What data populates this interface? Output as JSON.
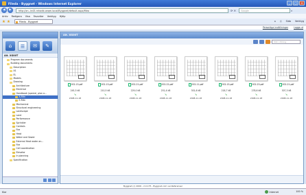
{
  "window": {
    "title": "Fileda - Byggnet - Windows Internet Explorer"
  },
  "address_bar": {
    "url": "http://xn--ln43-rnhadb.xeqm.local/Byggnet/default.aspx/fileo",
    "search_placeholder": "Google"
  },
  "menu": [
    "Arkiv",
    "Redigera",
    "Visa",
    "Favoriter",
    "Verktyg",
    "Hjälp"
  ],
  "tab": {
    "label": "Fileda - Byggnet"
  },
  "fav_tools": [
    "Sida",
    "Verktyg"
  ],
  "app_links": [
    "Personliga inställningar",
    "Logga ut"
  ],
  "right_header": "Alt. XG00T",
  "right_search_placeholder": "Sök i ritning",
  "sidebar": {
    "title": "Alt. XG00T",
    "tree": [
      {
        "label": "Program documents",
        "level": 1
      },
      {
        "label": "Building documents",
        "level": 1
      },
      {
        "label": "Description",
        "level": 2
      },
      {
        "label": "A1",
        "level": 2
      },
      {
        "label": "EL",
        "level": 2
      },
      {
        "label": "Models",
        "level": 2
      },
      {
        "label": "Drawing",
        "level": 2
      },
      {
        "label": "Architecture",
        "level": 3
      },
      {
        "label": "Electrical",
        "level": 3
      },
      {
        "label": "Handbook (special, plan o...",
        "level": 3
      },
      {
        "label": "A-Ritn",
        "level": 4,
        "selected": true
      },
      {
        "label": "E-Ritn",
        "level": 4
      },
      {
        "label": "Mechanical",
        "level": 3
      },
      {
        "label": "Structural engineering",
        "level": 3
      },
      {
        "label": "Landscape",
        "level": 3
      },
      {
        "label": "Land",
        "level": 3
      },
      {
        "label": "Performance",
        "level": 3
      },
      {
        "label": "Sprinkler",
        "level": 3
      },
      {
        "label": "Controls",
        "level": 3
      },
      {
        "label": "Fire",
        "level": 3
      },
      {
        "label": "Heat",
        "level": 3
      },
      {
        "label": "Water and Sewer",
        "level": 3
      },
      {
        "label": "External Heat water an...",
        "level": 3
      },
      {
        "label": "Fire",
        "level": 3
      },
      {
        "label": "Cell coordination",
        "level": 3
      },
      {
        "label": "Elevator",
        "level": 3
      },
      {
        "label": "In planning",
        "level": 3
      },
      {
        "label": "Specification",
        "level": 2
      }
    ]
  },
  "files": [
    {
      "name": "002-13.pdf",
      "size": "245,3 kB",
      "date": "2008-11-18"
    },
    {
      "name": "002-13.pdf",
      "size": "210,5 kB",
      "date": "2008-11-18"
    },
    {
      "name": "002-21.pdf",
      "size": "229,0 kB",
      "date": "2008-11-18"
    },
    {
      "name": "002-22.pdf",
      "size": "251,4 kB",
      "date": "2008-11-18"
    },
    {
      "name": "002-11.pdf",
      "size": "301,6 kB",
      "date": "2008-11-18"
    },
    {
      "name": "002-15.pdf",
      "size": "218,7 kB",
      "date": "2008-11-18"
    },
    {
      "name": "002-23.pdf",
      "size": "278,6 kB",
      "date": "2008-11-18"
    },
    {
      "name": "002-21.pdf",
      "size": "307,3 kB",
      "date": "2008-11-18"
    }
  ],
  "footer": "Byggnet (c) 2006 - 2.0.175 - Byggnet.com ver.Referenser",
  "status": {
    "left": "Klar",
    "zone": "Internet",
    "zoom": "100 %"
  }
}
